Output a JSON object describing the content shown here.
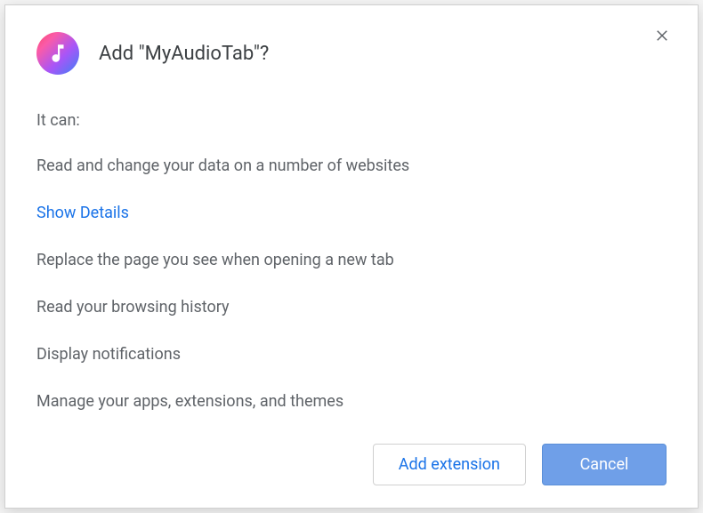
{
  "dialog": {
    "title": "Add \"MyAudioTab\"?",
    "intro": "It can:",
    "permissions": [
      "Read and change your data on a number of websites",
      "Replace the page you see when opening a new tab",
      "Read your browsing history",
      "Display notifications",
      "Manage your apps, extensions, and themes"
    ],
    "show_details": "Show Details",
    "buttons": {
      "add": "Add extension",
      "cancel": "Cancel"
    }
  }
}
